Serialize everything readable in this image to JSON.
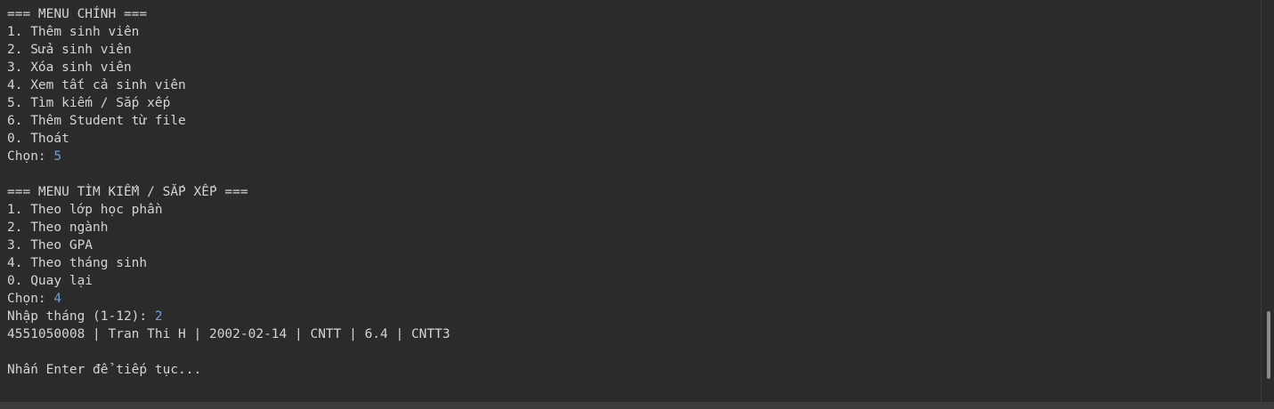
{
  "console": {
    "lines": [
      {
        "text": "=== MENU CHÍNH ==="
      },
      {
        "text": "1. Thêm sinh viên"
      },
      {
        "text": "2. Sửa sinh viên"
      },
      {
        "text": "3. Xóa sinh viên"
      },
      {
        "text": "4. Xem tất cả sinh viên"
      },
      {
        "text": "5. Tìm kiếm / Sắp xếp"
      },
      {
        "text": "6. Thêm Student từ file"
      },
      {
        "text": "0. Thoát"
      },
      {
        "text": "Chọn: ",
        "input": "5"
      },
      {
        "text": ""
      },
      {
        "text": "=== MENU TÌM KIẾM / SẮP XẾP ==="
      },
      {
        "text": "1. Theo lớp học phần"
      },
      {
        "text": "2. Theo ngành"
      },
      {
        "text": "3. Theo GPA"
      },
      {
        "text": "4. Theo tháng sinh"
      },
      {
        "text": "0. Quay lại"
      },
      {
        "text": "Chọn: ",
        "input": "4"
      },
      {
        "text": "Nhập tháng (1-12): ",
        "input": "2"
      },
      {
        "text": "4551050008 | Tran Thi H | 2002-02-14 | CNTT | 6.4 | CNTT3"
      },
      {
        "text": ""
      },
      {
        "text": "Nhấn Enter để tiếp tục..."
      }
    ]
  },
  "scrollbar": {
    "vertical_position": 0.93,
    "thumb_color": "#8a8a8a"
  },
  "colors": {
    "background": "#2b2b2b",
    "text": "#d4d4d4",
    "input": "#6f9fd8"
  }
}
